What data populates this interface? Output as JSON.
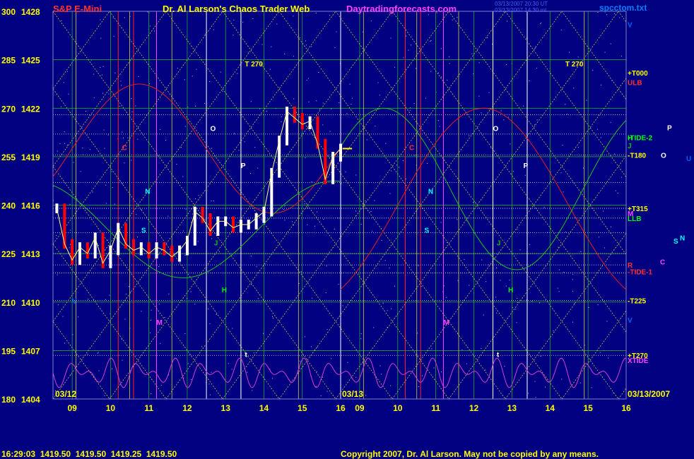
{
  "header": {
    "symbol": "S&P E-Mini",
    "title": "Dr. Al Larson's Chaos Trader Web",
    "site": "Daytradingforecasts.com",
    "file": "spcctom.txt",
    "timestamp1": "03/13/2007 20:30 UT",
    "timestamp2": "03/13/2007 14:30 mt"
  },
  "footer": {
    "quote": "16:29:03  1419.50  1419.50  1419.25  1419.50",
    "copyright": "Copyright 2007, Dr. Al Larson. May not be copied by any means."
  },
  "colors": {
    "background": "#000080",
    "price_up": "#ffffff",
    "price_down": "#ff0000",
    "grid_yellow": "#d8d840",
    "grid_green": "#20c020",
    "accent_yellow": "#ffff00",
    "accent_magenta": "#ff40ff",
    "accent_cyan": "#00ffff"
  },
  "chart_data": {
    "type": "line",
    "y_left_labels": [
      "300",
      "285",
      "270",
      "255",
      "240",
      "225",
      "210",
      "195",
      "180"
    ],
    "y_price_labels": [
      "1428",
      "1425",
      "1422",
      "1419",
      "1416",
      "1413",
      "1410",
      "1407",
      "1404"
    ],
    "ylim": [
      1404,
      1428
    ],
    "panel1_date": "03/12",
    "panel2_date": "03/13",
    "panel2_end_date": "03/13/2007",
    "hour_labels": [
      "09",
      "10",
      "11",
      "12",
      "13",
      "14",
      "15",
      "16"
    ],
    "price_series": [
      {
        "t": 8.6,
        "v": 1415.8
      },
      {
        "t": 8.8,
        "v": 1413.6
      },
      {
        "t": 9.0,
        "v": 1412.6
      },
      {
        "t": 9.2,
        "v": 1413.4
      },
      {
        "t": 9.4,
        "v": 1413.0
      },
      {
        "t": 9.6,
        "v": 1414.0
      },
      {
        "t": 9.8,
        "v": 1412.4
      },
      {
        "t": 10.0,
        "v": 1413.2
      },
      {
        "t": 10.2,
        "v": 1414.6
      },
      {
        "t": 10.4,
        "v": 1413.6
      },
      {
        "t": 10.6,
        "v": 1413.2
      },
      {
        "t": 10.8,
        "v": 1413.4
      },
      {
        "t": 11.0,
        "v": 1413.0
      },
      {
        "t": 11.2,
        "v": 1413.4
      },
      {
        "t": 11.4,
        "v": 1413.2
      },
      {
        "t": 11.6,
        "v": 1412.8
      },
      {
        "t": 11.8,
        "v": 1413.2
      },
      {
        "t": 12.0,
        "v": 1413.8
      },
      {
        "t": 12.2,
        "v": 1415.6
      },
      {
        "t": 12.4,
        "v": 1415.2
      },
      {
        "t": 12.6,
        "v": 1414.4
      },
      {
        "t": 12.8,
        "v": 1415.0
      },
      {
        "t": 13.0,
        "v": 1415.0
      },
      {
        "t": 13.2,
        "v": 1414.6
      },
      {
        "t": 13.4,
        "v": 1414.8
      },
      {
        "t": 13.6,
        "v": 1414.8
      },
      {
        "t": 13.8,
        "v": 1415.2
      },
      {
        "t": 14.0,
        "v": 1415.6
      },
      {
        "t": 14.2,
        "v": 1418.0
      },
      {
        "t": 14.4,
        "v": 1420.0
      },
      {
        "t": 14.6,
        "v": 1421.8
      },
      {
        "t": 14.8,
        "v": 1421.4
      },
      {
        "t": 15.0,
        "v": 1421.0
      },
      {
        "t": 15.2,
        "v": 1421.2
      },
      {
        "t": 15.4,
        "v": 1419.8
      },
      {
        "t": 15.6,
        "v": 1417.6
      },
      {
        "t": 15.8,
        "v": 1419.0
      },
      {
        "t": 16.0,
        "v": 1419.5
      }
    ],
    "panel1_labels": [
      {
        "text": "T 270",
        "t": 13.5,
        "v": 1424.6,
        "color": "#ffff00"
      },
      {
        "text": "C",
        "t": 10.3,
        "v": 1419.4,
        "color": "#ff3030"
      },
      {
        "text": "N",
        "t": 10.9,
        "v": 1416.7,
        "color": "#00ffff"
      },
      {
        "text": "S",
        "t": 10.8,
        "v": 1414.3,
        "color": "#00ffff"
      },
      {
        "text": "O",
        "t": 12.6,
        "v": 1420.6,
        "color": "#ffffff"
      },
      {
        "text": "P",
        "t": 13.4,
        "v": 1418.3,
        "color": "#ffffff"
      },
      {
        "text": "J",
        "t": 12.7,
        "v": 1413.5,
        "color": "#00c000"
      },
      {
        "text": "H",
        "t": 12.9,
        "v": 1410.6,
        "color": "#00ff00"
      },
      {
        "text": "V",
        "t": 9.0,
        "v": 1409.9,
        "color": "#0060ff"
      },
      {
        "text": "M",
        "t": 11.2,
        "v": 1408.6,
        "color": "#ff40ff"
      },
      {
        "text": "t",
        "t": 13.5,
        "v": 1406.6,
        "color": "#ffffff"
      }
    ],
    "panel2_labels": [
      {
        "text": "T 270",
        "t": 14.4,
        "v": 1424.6,
        "color": "#ffff00"
      },
      {
        "text": "C",
        "t": 10.3,
        "v": 1419.4,
        "color": "#ff3030"
      },
      {
        "text": "N",
        "t": 10.8,
        "v": 1416.7,
        "color": "#00ffff"
      },
      {
        "text": "S",
        "t": 10.7,
        "v": 1414.3,
        "color": "#00ffff"
      },
      {
        "text": "O",
        "t": 12.5,
        "v": 1420.6,
        "color": "#ffffff"
      },
      {
        "text": "P",
        "t": 13.3,
        "v": 1418.3,
        "color": "#ffffff"
      },
      {
        "text": "J",
        "t": 12.6,
        "v": 1413.5,
        "color": "#00c000"
      },
      {
        "text": "H",
        "t": 12.9,
        "v": 1410.6,
        "color": "#00ff00"
      },
      {
        "text": "M",
        "t": 11.2,
        "v": 1408.6,
        "color": "#ff40ff"
      },
      {
        "text": "t",
        "t": 12.6,
        "v": 1406.6,
        "color": "#ffffff"
      }
    ],
    "right_labels": [
      {
        "text": "V",
        "v": 1427.2,
        "color": "#0060ff"
      },
      {
        "text": "+T000",
        "v": 1424.2,
        "color": "#ffff00"
      },
      {
        "text": "ULB",
        "v": 1423.6,
        "color": "#ff3030"
      },
      {
        "text": "H",
        "v": 1420.2,
        "color": "#00ff00"
      },
      {
        "text": "-TIDE-2",
        "v": 1420.2,
        "color": "#00ff00"
      },
      {
        "text": "J",
        "v": 1419.7,
        "color": "#00c000"
      },
      {
        "text": "-T180",
        "v": 1419.1,
        "color": "#ffff00"
      },
      {
        "text": "+T315",
        "v": 1415.8,
        "color": "#ffff00"
      },
      {
        "text": "M",
        "v": 1415.5,
        "color": "#ff40ff"
      },
      {
        "text": "LLB",
        "v": 1415.2,
        "color": "#00ff00"
      },
      {
        "text": "R",
        "v": 1412.3,
        "color": "#ff3030"
      },
      {
        "text": "-TIDE-1",
        "v": 1411.9,
        "color": "#ff3030"
      },
      {
        "text": "-T225",
        "v": 1410.1,
        "color": "#ffff00"
      },
      {
        "text": "V",
        "v": 1408.9,
        "color": "#0060ff"
      },
      {
        "text": "+T270",
        "v": 1406.7,
        "color": "#ffff00"
      },
      {
        "text": "XTIDE",
        "v": 1406.4,
        "color": "#ff40ff"
      }
    ],
    "far_right_labels": [
      {
        "text": "P",
        "v": 1420.8,
        "color": "#ffffff"
      },
      {
        "text": "O",
        "v": 1419.1,
        "color": "#ffffff"
      },
      {
        "text": "U",
        "v": 1418.9,
        "color": "#0060ff"
      },
      {
        "text": "N",
        "v": 1414.0,
        "color": "#00ffff"
      },
      {
        "text": "S",
        "v": 1413.8,
        "color": "#00ffff"
      },
      {
        "text": "C",
        "v": 1412.5,
        "color": "#ff40ff"
      }
    ]
  }
}
